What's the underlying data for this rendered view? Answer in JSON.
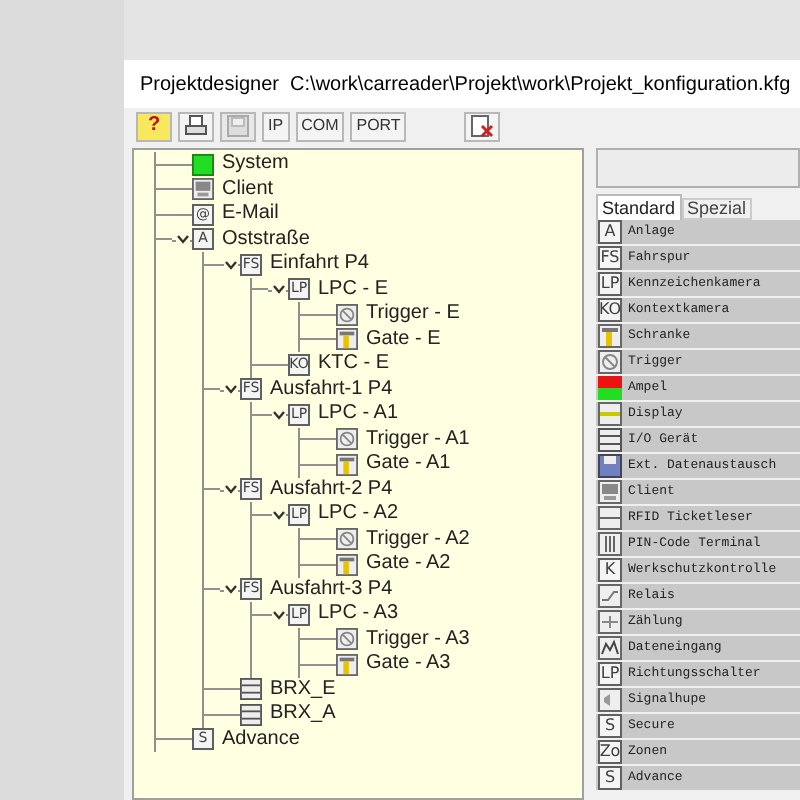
{
  "window": {
    "title": "Projektdesigner  C:\\work\\carreader\\Projekt\\work\\Projekt_konfiguration.kfg"
  },
  "toolbar": [
    {
      "kind": "help",
      "text": "?",
      "disabled": false
    },
    {
      "kind": "printer",
      "disabled": false
    },
    {
      "kind": "save",
      "disabled": true
    },
    {
      "kind": "text",
      "text": "IP",
      "disabled": false
    },
    {
      "kind": "text",
      "text": "COM",
      "disabled": false
    },
    {
      "kind": "text",
      "text": "PORT",
      "disabled": false
    },
    {
      "kind": "export",
      "disabled": false
    }
  ],
  "tree": [
    {
      "label": "System",
      "kind": "system"
    },
    {
      "label": "Client",
      "kind": "client"
    },
    {
      "label": "E-Mail",
      "kind": "letter",
      "badge": "@"
    },
    {
      "label": "Oststraße",
      "kind": "letter",
      "badge": "A",
      "expanded": true,
      "children": [
        {
          "label": "Einfahrt P4",
          "kind": "letter",
          "badge": "FS",
          "expanded": true,
          "children": [
            {
              "label": "LPC - E",
              "kind": "letter",
              "badge": "LP",
              "expanded": true,
              "children": [
                {
                  "label": "Trigger - E",
                  "kind": "trigger"
                },
                {
                  "label": "Gate - E",
                  "kind": "gate"
                }
              ]
            },
            {
              "label": "KTC - E",
              "kind": "letter",
              "badge": "KO"
            }
          ]
        },
        {
          "label": "Ausfahrt-1 P4",
          "kind": "letter",
          "badge": "FS",
          "expanded": true,
          "children": [
            {
              "label": "LPC - A1",
              "kind": "letter",
              "badge": "LP",
              "expanded": true,
              "children": [
                {
                  "label": "Trigger - A1",
                  "kind": "trigger"
                },
                {
                  "label": "Gate - A1",
                  "kind": "gate"
                }
              ]
            }
          ]
        },
        {
          "label": "Ausfahrt-2 P4",
          "kind": "letter",
          "badge": "FS",
          "expanded": true,
          "children": [
            {
              "label": "LPC - A2",
              "kind": "letter",
              "badge": "LP",
              "expanded": true,
              "children": [
                {
                  "label": "Trigger - A2",
                  "kind": "trigger"
                },
                {
                  "label": "Gate - A2",
                  "kind": "gate"
                }
              ]
            }
          ]
        },
        {
          "label": "Ausfahrt-3 P4",
          "kind": "letter",
          "badge": "FS",
          "expanded": true,
          "children": [
            {
              "label": "LPC - A3",
              "kind": "letter",
              "badge": "LP",
              "expanded": true,
              "children": [
                {
                  "label": "Trigger - A3",
                  "kind": "trigger"
                },
                {
                  "label": "Gate - A3",
                  "kind": "gate"
                }
              ]
            }
          ]
        },
        {
          "label": "BRX_E",
          "kind": "brx"
        },
        {
          "label": "BRX_A",
          "kind": "brx"
        }
      ]
    },
    {
      "label": "Advance",
      "kind": "letter",
      "badge": "S"
    }
  ],
  "palette_tabs": [
    {
      "label": "Standard",
      "selected": true
    },
    {
      "label": "Spezial",
      "selected": false
    }
  ],
  "palette": [
    {
      "label": "Anlage",
      "kind": "letter",
      "badge": "A"
    },
    {
      "label": "Fahrspur",
      "kind": "letter",
      "badge": "FS"
    },
    {
      "label": "Kennzeichenkamera",
      "kind": "letter",
      "badge": "LP"
    },
    {
      "label": "Kontextkamera",
      "kind": "letter",
      "badge": "KO"
    },
    {
      "label": "Schranke",
      "kind": "gate"
    },
    {
      "label": "Trigger",
      "kind": "trigger"
    },
    {
      "label": "Ampel",
      "kind": "light"
    },
    {
      "label": "Display",
      "kind": "display"
    },
    {
      "label": "I/O Gerät",
      "kind": "brx"
    },
    {
      "label": "Ext. Datenaustausch",
      "kind": "disk"
    },
    {
      "label": "Client",
      "kind": "client"
    },
    {
      "label": "RFID Ticketleser",
      "kind": "reader"
    },
    {
      "label": "PIN-Code Terminal",
      "kind": "keypad"
    },
    {
      "label": "Werkschutzkontrolle",
      "kind": "letter",
      "badge": "K"
    },
    {
      "label": "Relais",
      "kind": "relay"
    },
    {
      "label": "Zählung",
      "kind": "counter"
    },
    {
      "label": "Dateneingang",
      "kind": "chart"
    },
    {
      "label": "Richtungsschalter",
      "kind": "letter",
      "badge": "LP"
    },
    {
      "label": "Signalhupe",
      "kind": "horn"
    },
    {
      "label": "Secure",
      "kind": "letter",
      "badge": "S"
    },
    {
      "label": "Zonen",
      "kind": "letter",
      "badge": "Zo"
    },
    {
      "label": "Advance",
      "kind": "letter",
      "badge": "S"
    }
  ]
}
